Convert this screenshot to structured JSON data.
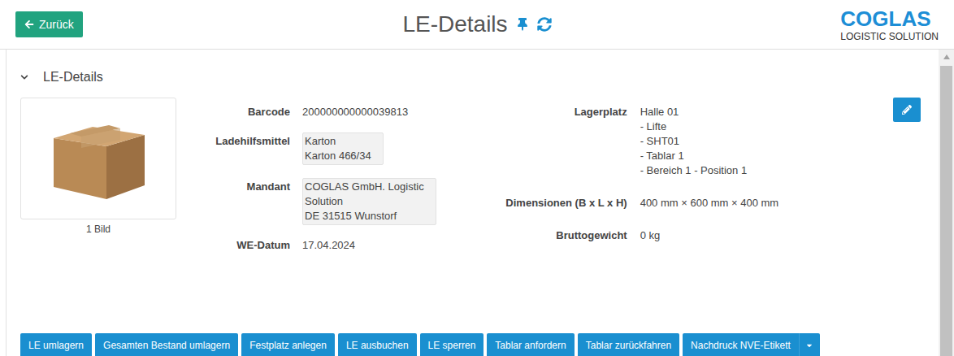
{
  "header": {
    "back_button": "Zurück",
    "title": "LE-Details",
    "logo": {
      "name": "COGLAS",
      "subtitle": "LOGISTIC SOLUTION"
    }
  },
  "section": {
    "title": "LE-Details",
    "expanded": true
  },
  "image": {
    "caption": "1 Bild"
  },
  "left_fields": [
    {
      "label": "Barcode",
      "kind": "plain",
      "lines": [
        "200000000000039813"
      ]
    },
    {
      "label": "Ladehilfsmittel",
      "kind": "boxed",
      "lines": [
        "Karton",
        "Karton 466/34"
      ]
    },
    {
      "label": "Mandant",
      "kind": "boxed",
      "lines": [
        "COGLAS GmbH. Logistic",
        "Solution",
        "DE 31515 Wunstorf"
      ]
    },
    {
      "label": "WE-Datum",
      "kind": "plain",
      "lines": [
        "17.04.2024"
      ]
    }
  ],
  "right_fields": [
    {
      "label": "Lagerplatz",
      "lines": [
        "Halle 01",
        "- Lifte",
        "- SHT01",
        "- Tablar 1",
        "- Bereich 1 - Position 1"
      ]
    },
    {
      "label": "Dimensionen (B x L x H)",
      "lines": [
        "400 mm × 600 mm × 400 mm"
      ]
    },
    {
      "label": "Bruttogewicht",
      "lines": [
        "0 kg"
      ]
    }
  ],
  "buttons": [
    {
      "label": "LE umlagern",
      "dropdown": false
    },
    {
      "label": "Gesamten Bestand umlagern",
      "dropdown": false
    },
    {
      "label": "Festplatz anlegen",
      "dropdown": false
    },
    {
      "label": "LE ausbuchen",
      "dropdown": false
    },
    {
      "label": "LE sperren",
      "dropdown": false
    },
    {
      "label": "Tablar anfordern",
      "dropdown": false
    },
    {
      "label": "Tablar zurückfahren",
      "dropdown": false
    },
    {
      "label": "Nachdruck NVE-Etikett",
      "dropdown": true
    }
  ]
}
